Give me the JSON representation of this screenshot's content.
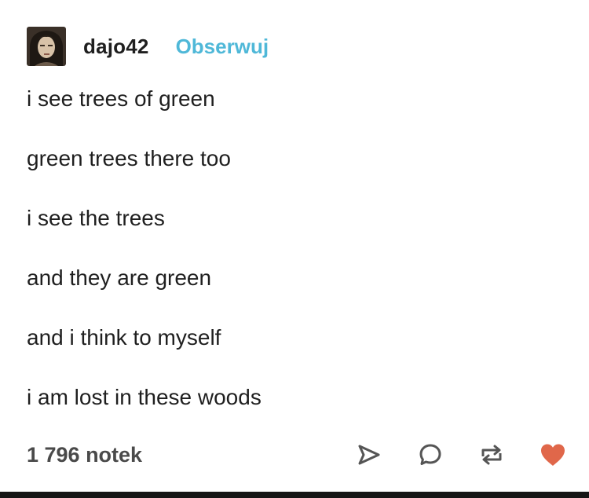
{
  "post": {
    "author": "dajo42",
    "follow_label": "Obserwuj",
    "lines": [
      "i see trees of green",
      "green trees there too",
      "i see the trees",
      "and they are green",
      "and i think to myself",
      "i am lost in these woods"
    ],
    "notes": "1 796 notek"
  },
  "colors": {
    "follow": "#4fb8d8",
    "like": "#e0674a",
    "text": "#1f1f1f",
    "icon": "#555555"
  },
  "icons": {
    "avatar": "avatar-image",
    "share": "share-icon",
    "reply": "reply-icon",
    "reblog": "reblog-icon",
    "like": "heart-icon"
  }
}
